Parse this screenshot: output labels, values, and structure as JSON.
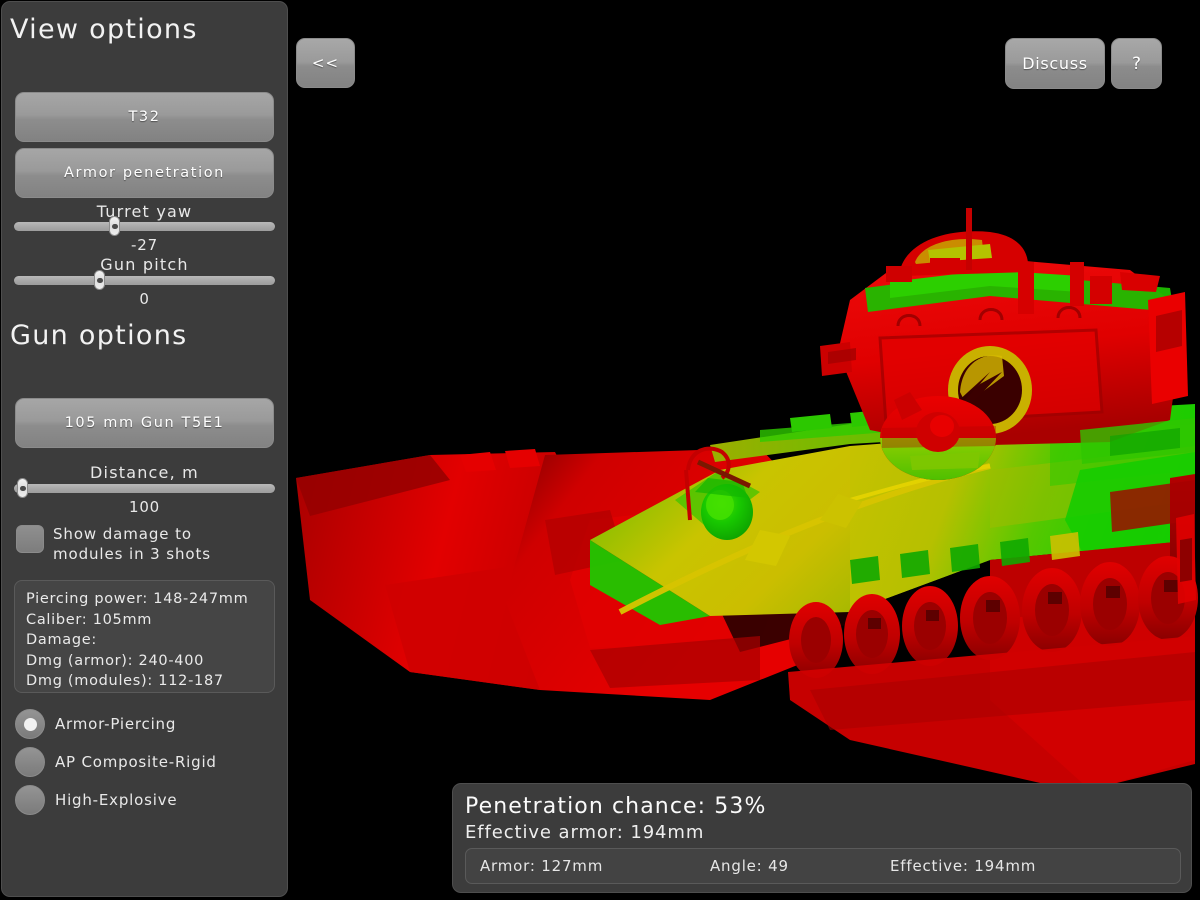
{
  "sidebar": {
    "view_options_title": "View options",
    "gun_options_title": "Gun options",
    "tank_button": "T32",
    "mode_button": "Armor penetration",
    "sliders": [
      {
        "label": "Turret yaw",
        "value": "-27",
        "percent": 38
      },
      {
        "label": "Gun pitch",
        "value": "0",
        "percent": 32
      }
    ],
    "gun_button": "105 mm Gun T5E1",
    "distance_slider": {
      "label": "Distance, m",
      "value": "100",
      "percent": 1
    },
    "checkbox": {
      "label": "Show damage to\nmodules in 3 shots",
      "checked": false
    },
    "info": {
      "piercing_power": "Piercing power: 148-247mm",
      "caliber": "Caliber: 105mm",
      "damage": "Damage:",
      "dmg_armor": "Dmg (armor): 240-400",
      "dmg_modules": "Dmg (modules): 112-187"
    },
    "shell_types": [
      {
        "label": "Armor-Piercing",
        "selected": true
      },
      {
        "label": "AP Composite-Rigid",
        "selected": false
      },
      {
        "label": "High-Explosive",
        "selected": false
      }
    ]
  },
  "toolbar": {
    "back_label": "<<",
    "discuss_label": "Discuss",
    "help_label": "?"
  },
  "result": {
    "penetration_chance": "Penetration chance: 53%",
    "effective_armor": "Effective armor: 194mm",
    "armor": "Armor: 127mm",
    "angle": "Angle: 49",
    "effective": "Effective: 194mm"
  },
  "colors": {
    "background": "#000000",
    "panel": "#3c3c3c",
    "panel_inner": "#454545",
    "button": "#9a9a9a",
    "text": "#eeeeee",
    "armor_safe": "#00cc00",
    "armor_weak": "#dd0000",
    "armor_mid": "#b0b000"
  },
  "scene": {
    "model_name": "T32",
    "view": "front-three-quarter",
    "render_mode": "armor-penetration-heatmap"
  }
}
